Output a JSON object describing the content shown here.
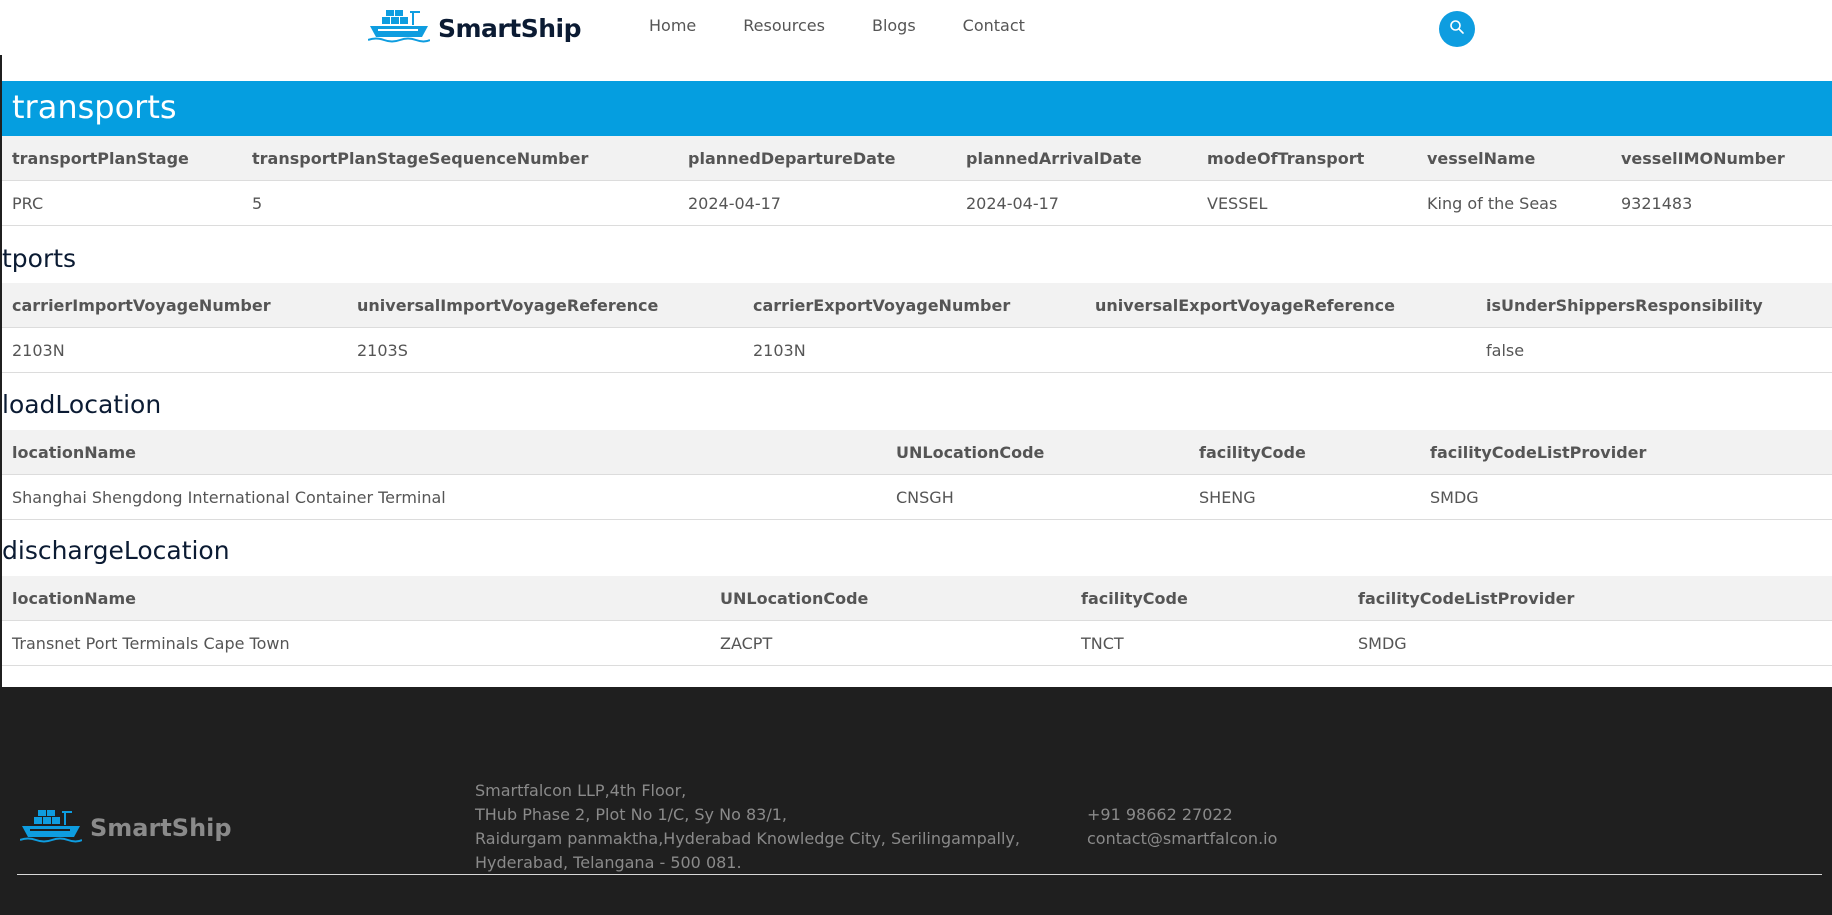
{
  "header": {
    "brand": "SmartShip",
    "nav": [
      "Home",
      "Resources",
      "Blogs",
      "Contact"
    ],
    "icons": {
      "logo": "ship-logo-icon",
      "search": "search-icon"
    },
    "colors": {
      "accent": "#059ee0",
      "brand_text": "#0b1b33"
    }
  },
  "banner": {
    "title": "transports"
  },
  "transports_table": {
    "headers": [
      "transportPlanStage",
      "transportPlanStageSequenceNumber",
      "plannedDepartureDate",
      "plannedArrivalDate",
      "modeOfTransport",
      "vesselName",
      "vesselIMONumber"
    ],
    "row": [
      "PRC",
      "5",
      "2024-04-17",
      "2024-04-17",
      "VESSEL",
      "King of the Seas",
      "9321483"
    ]
  },
  "voyage_section": {
    "title": "tports",
    "headers": [
      "carrierImportVoyageNumber",
      "universalImportVoyageReference",
      "carrierExportVoyageNumber",
      "universalExportVoyageReference",
      "isUnderShippersResponsibility"
    ],
    "row": [
      "2103N",
      "2103S",
      "2103N",
      "",
      "false"
    ]
  },
  "load_location": {
    "title": "loadLocation",
    "headers": [
      "locationName",
      "UNLocationCode",
      "facilityCode",
      "facilityCodeListProvider"
    ],
    "row": [
      "Shanghai Shengdong International Container Terminal",
      "CNSGH",
      "SHENG",
      "SMDG"
    ]
  },
  "discharge_location": {
    "title": "dischargeLocation",
    "headers": [
      "locationName",
      "UNLocationCode",
      "facilityCode",
      "facilityCodeListProvider"
    ],
    "row": [
      "Transnet Port Terminals Cape Town",
      "ZACPT",
      "TNCT",
      "SMDG"
    ]
  },
  "footer": {
    "brand": "SmartShip",
    "address_lines": [
      "Smartfalcon LLP,4th Floor,",
      "THub Phase 2, Plot No 1/C, Sy No 83/1,",
      "Raidurgam panmaktha,Hyderabad Knowledge City, Serilingampally,",
      "Hyderabad, Telangana - 500 081."
    ],
    "phone": "+91 98662 27022",
    "email": "contact@smartfalcon.io"
  }
}
